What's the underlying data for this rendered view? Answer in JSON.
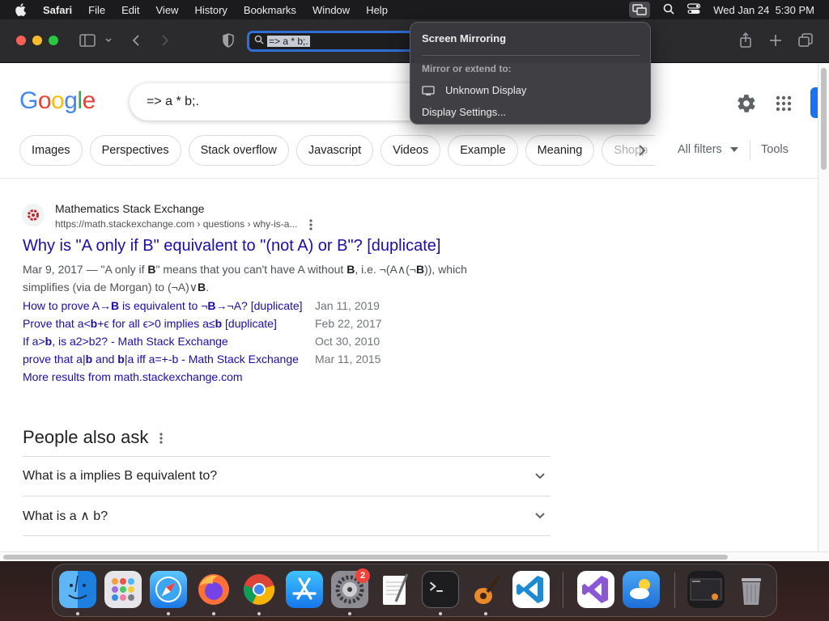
{
  "menubar": {
    "app_name": "Safari",
    "items": [
      "File",
      "Edit",
      "View",
      "History",
      "Bookmarks",
      "Window",
      "Help"
    ],
    "clock": "Wed Jan 24  5:30 PM"
  },
  "toolbar": {
    "address_text": "=> a * b;."
  },
  "google": {
    "logo_letters": [
      "G",
      "o",
      "o",
      "g",
      "l",
      "e"
    ],
    "logo_colors": [
      "#4285F4",
      "#EA4335",
      "#FBBC05",
      "#4285F4",
      "#34A853",
      "#EA4335"
    ],
    "query": "=> a * b;.",
    "chips": [
      "Images",
      "Perspectives",
      "Stack overflow",
      "Javascript",
      "Videos",
      "Example",
      "Meaning"
    ],
    "chip_faded": "Shopp",
    "all_filters": "All filters",
    "tools": "Tools"
  },
  "result": {
    "site_name": "Mathematics Stack Exchange",
    "url": "https://math.stackexchange.com › questions › why-is-a...",
    "title": "Why is \"A only if B\" equivalent to \"(not A) or B\"? [duplicate]",
    "snippet_date": "Mar 9, 2017",
    "snippet_dash": " — ",
    "snippet_parts": [
      "\"A only if ",
      "B",
      "\" means that you can't have A without ",
      "B",
      ", i.e. ¬(A∧(¬",
      "B",
      ")), which simplifies (via de Morgan) to (¬A)∨",
      "B",
      "."
    ],
    "sublinks": [
      {
        "parts": [
          "How to prove A→",
          "B",
          " is equivalent to ¬",
          "B",
          "→¬A? [duplicate]"
        ],
        "date": "Jan 11, 2019"
      },
      {
        "parts": [
          "Prove that a<",
          "b",
          "+ϵ for all ϵ>0 implies a≤",
          "b",
          " [duplicate]"
        ],
        "date": "Feb 22, 2017"
      },
      {
        "parts": [
          "If a>",
          "b",
          ", is a2>b2? - Math Stack Exchange",
          "",
          ""
        ],
        "date": "Oct 30, 2010"
      },
      {
        "parts": [
          "prove that a|",
          "b",
          " and ",
          "b",
          "|a iff a=+-b - Math Stack Exchange"
        ],
        "date": "Mar 11, 2015"
      }
    ],
    "more_results": "More results from math.stackexchange.com"
  },
  "paa": {
    "title": "People also ask",
    "questions": [
      "What is a implies B equivalent to?",
      "What is a ∧ b?"
    ]
  },
  "popover": {
    "title": "Screen Mirroring",
    "subtitle": "Mirror or extend to:",
    "display": "Unknown Display",
    "settings": "Display Settings..."
  },
  "dock": {
    "badge_count": "2"
  }
}
